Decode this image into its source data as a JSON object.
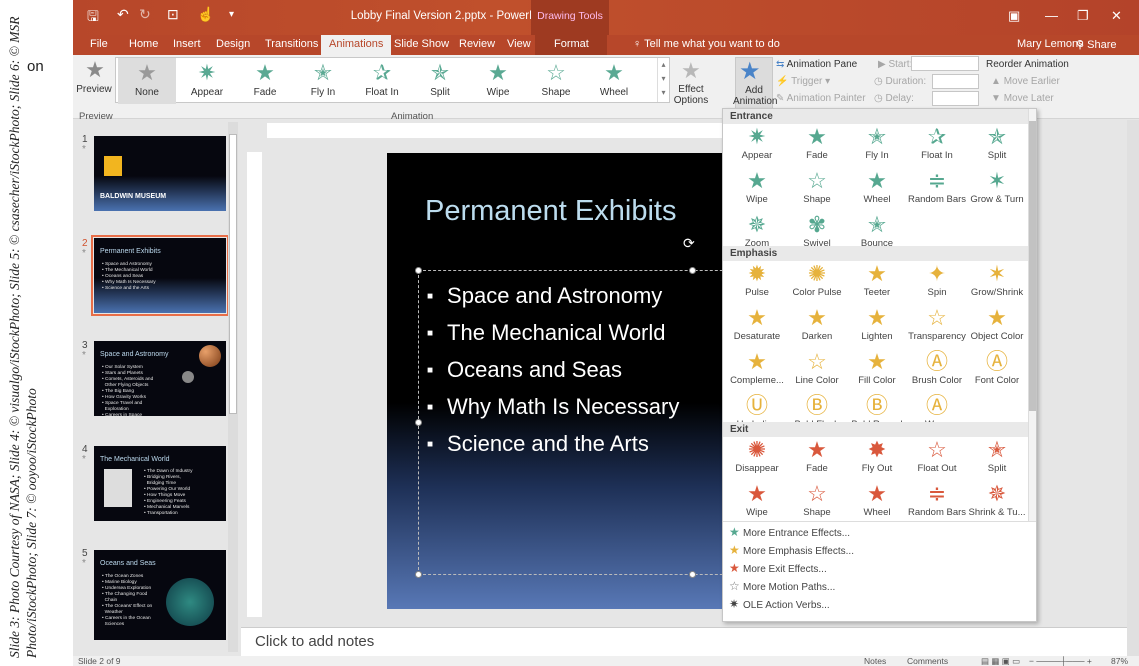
{
  "side": {
    "credit": "Slide 3: Photo Courtesy of NASA; Slide 4: © visualgo/iStockPhoto; Slide 5: © csasecher/iStockPhoto; Slide 6: © MSR Photo/iStockPhoto; Slide 7: © ooyoo/iStockPhoto",
    "page_fragment": "on"
  },
  "window": {
    "title": "Lobby Final Version 2.pptx - PowerPoint",
    "context_tools": "Drawing Tools",
    "user": "Mary Lemons",
    "share": "Share",
    "tell_me": "Tell me what you want to do"
  },
  "tabs": [
    "File",
    "Home",
    "Insert",
    "Design",
    "Transitions",
    "Animations",
    "Slide Show",
    "Review",
    "View",
    "Format"
  ],
  "active_tab": "Animations",
  "ribbon": {
    "preview_label": "Preview",
    "gallery": [
      {
        "label": "None",
        "icon": "none-star-icon"
      },
      {
        "label": "Appear",
        "icon": "appear-star-icon"
      },
      {
        "label": "Fade",
        "icon": "fade-star-icon"
      },
      {
        "label": "Fly In",
        "icon": "fly-in-star-icon"
      },
      {
        "label": "Float In",
        "icon": "float-in-star-icon"
      },
      {
        "label": "Split",
        "icon": "split-star-icon"
      },
      {
        "label": "Wipe",
        "icon": "wipe-star-icon"
      },
      {
        "label": "Shape",
        "icon": "shape-star-icon"
      },
      {
        "label": "Wheel",
        "icon": "wheel-star-icon"
      }
    ],
    "effect_options": "Effect Options",
    "add_animation": "Add Animation",
    "animation_pane": "Animation Pane",
    "trigger": "Trigger",
    "animation_painter": "Animation Painter",
    "start_label": "Start:",
    "duration_label": "Duration:",
    "delay_label": "Delay:",
    "reorder": "Reorder Animation",
    "move_earlier": "Move Earlier",
    "move_later": "Move Later",
    "group_preview": "Preview",
    "group_animation": "Animation"
  },
  "thumbnails": [
    {
      "num": "1",
      "title": "BALDWIN MUSEUM",
      "bullets": ""
    },
    {
      "num": "2",
      "title": "Permanent Exhibits",
      "bullets": "• Space and Astronomy\n• The Mechanical World\n• Oceans and Seas\n• Why Math Is Necessary\n• Science and the Arts"
    },
    {
      "num": "3",
      "title": "Space and Astronomy",
      "bullets": "• Our Solar System\n• Stars and Planets\n• Comets, Asteroids and\n  Other Flying Objects\n• The Big Bang\n• How Gravity Works\n• Space Travel and\n  Exploration\n• Careers in Space"
    },
    {
      "num": "4",
      "title": "The Mechanical World",
      "bullets": "• The Dawn of Industry\n• Bridging Rivers,\n  Bridging Time\n• Powering Our World\n• How Things Move\n• Engineering Feats\n• Mechanical Marvels\n• Transportation"
    },
    {
      "num": "5",
      "title": "Oceans and Seas",
      "bullets": "• The Ocean Zones\n• Marine Biology\n• Undersea Exploration\n• The Changing Food\n  Chain\n• The Oceans' Effect on\n  Weather\n• Careers in the Ocean\n  Sciences"
    }
  ],
  "slide": {
    "title": "Permanent Exhibits",
    "bullets": [
      "Space and Astronomy",
      "The Mechanical World",
      "Oceans and Seas",
      "Why Math Is Necessary",
      "Science and the Arts"
    ]
  },
  "notes_placeholder": "Click to add notes",
  "status": {
    "slide_of": "Slide 2 of 9",
    "notes": "Notes",
    "comments": "Comments",
    "zoom": "87%"
  },
  "dropdown": {
    "entrance_title": "Entrance",
    "entrance": [
      "Appear",
      "Fade",
      "Fly In",
      "Float In",
      "Split",
      "Wipe",
      "Shape",
      "Wheel",
      "Random Bars",
      "Grow & Turn",
      "Zoom",
      "Swivel",
      "Bounce"
    ],
    "emphasis_title": "Emphasis",
    "emphasis": [
      "Pulse",
      "Color Pulse",
      "Teeter",
      "Spin",
      "Grow/Shrink",
      "Desaturate",
      "Darken",
      "Lighten",
      "Transparency",
      "Object Color",
      "Compleme...",
      "Line Color",
      "Fill Color",
      "Brush Color",
      "Font Color",
      "Underline",
      "Bold Flash",
      "Bold Reveal",
      "Wave"
    ],
    "exit_title": "Exit",
    "exit": [
      "Disappear",
      "Fade",
      "Fly Out",
      "Float Out",
      "Split",
      "Wipe",
      "Shape",
      "Wheel",
      "Random Bars",
      "Shrink & Tu..."
    ],
    "more": [
      "More Entrance Effects...",
      "More Emphasis Effects...",
      "More Exit Effects...",
      "More Motion Paths...",
      "OLE Action Verbs..."
    ]
  },
  "colors": {
    "accent": "#b7472a",
    "entrance": "#56a890",
    "emphasis": "#e6b23c",
    "exit": "#d9583c",
    "slide_title": "#bcdcee"
  }
}
